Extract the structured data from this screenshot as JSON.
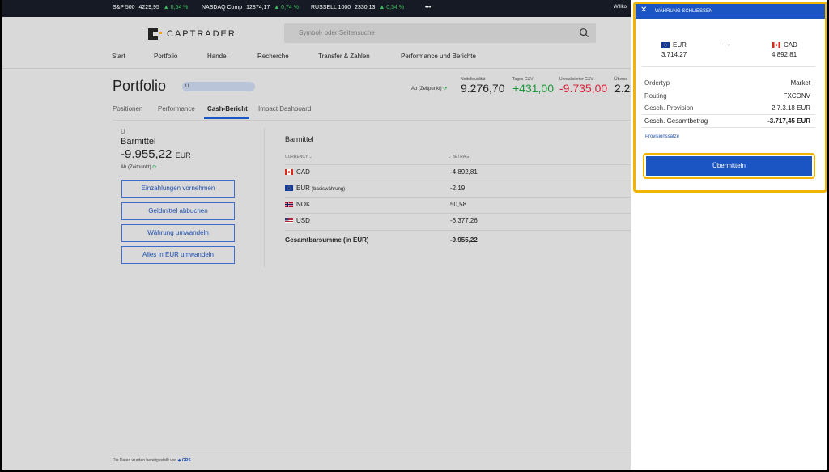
{
  "ticker": {
    "items": [
      {
        "name": "S&P 500",
        "value": "4229,95",
        "change": "▲ 0,54 %"
      },
      {
        "name": "NASDAQ Comp",
        "value": "12874,17",
        "change": "▲ 0,74 %"
      },
      {
        "name": "RUSSELL 1000",
        "value": "2330,13",
        "change": "▲ 0,54 %"
      }
    ],
    "more": "•••",
    "greeting": "Willko"
  },
  "header": {
    "logo": "CAPTRADER",
    "search_placeholder": "Symbol- oder Seitensuche",
    "nav": [
      "Start",
      "Portfolio",
      "Handel",
      "Recherche",
      "Transfer & Zahlen",
      "Performance und Berichte"
    ]
  },
  "portfolio": {
    "title": "Portfolio",
    "badge": "U",
    "asof": "Ab (Zeitpunkt)",
    "stats": [
      {
        "label": "Nettoliquidität",
        "value": "9.276,70",
        "color": "#222222"
      },
      {
        "label": "Tages-G&V",
        "value": "+431,00",
        "color": "#1a9a3a"
      },
      {
        "label": "Unrealisierter G&V",
        "value": "-9.735,00",
        "color": "#d6233b"
      },
      {
        "label": "Übersc",
        "value": "2.2",
        "color": "#222222"
      }
    ]
  },
  "tabs": [
    "Positionen",
    "Performance",
    "Cash-Bericht",
    "Impact Dashboard"
  ],
  "cash": {
    "account": "U",
    "label": "Barmittel",
    "value": "-9.955,22",
    "currency": "EUR",
    "asof": "Ab (Zeitpunkt)",
    "buttons": [
      "Einzahlungen vornehmen",
      "Geldmittel abbuchen",
      "Währung umwandeln",
      "Alles in EUR umwandeln"
    ]
  },
  "table": {
    "heading": "Barmittel",
    "col_currency": "CURRENCY ⌄",
    "col_amount": "⌄ BETRAG",
    "rows": [
      {
        "code": "CAD",
        "note": "",
        "amount": "-4.892,81"
      },
      {
        "code": "EUR",
        "note": "(basiswährung)",
        "amount": "-2,19"
      },
      {
        "code": "NOK",
        "note": "",
        "amount": "50,58"
      },
      {
        "code": "USD",
        "note": "",
        "amount": "-6.377,26"
      }
    ],
    "total_label": "Gesamtbarsumme (in EUR)",
    "total_value": "-9.955,22"
  },
  "footer": {
    "text": "Die Daten wurden bereitgestellt von",
    "brand": "GRS"
  },
  "panel": {
    "close_label": "WÄHRUNG SCHLIESSEN",
    "from": {
      "code": "EUR",
      "amount": "3.714,27"
    },
    "to": {
      "code": "CAD",
      "amount": "4.892,81"
    },
    "arrow": "→",
    "rows": [
      {
        "label": "Ordertyp",
        "value": "Market"
      },
      {
        "label": "Routing",
        "value": "FXCONV"
      },
      {
        "label": "Gesch. Provision",
        "value": "2.7.3.18 EUR"
      },
      {
        "label": "Gesch. Gesamtbetrag",
        "value": "-3.717,45 EUR"
      }
    ],
    "link": "Provisionssätze",
    "submit": "Übermitteln"
  }
}
